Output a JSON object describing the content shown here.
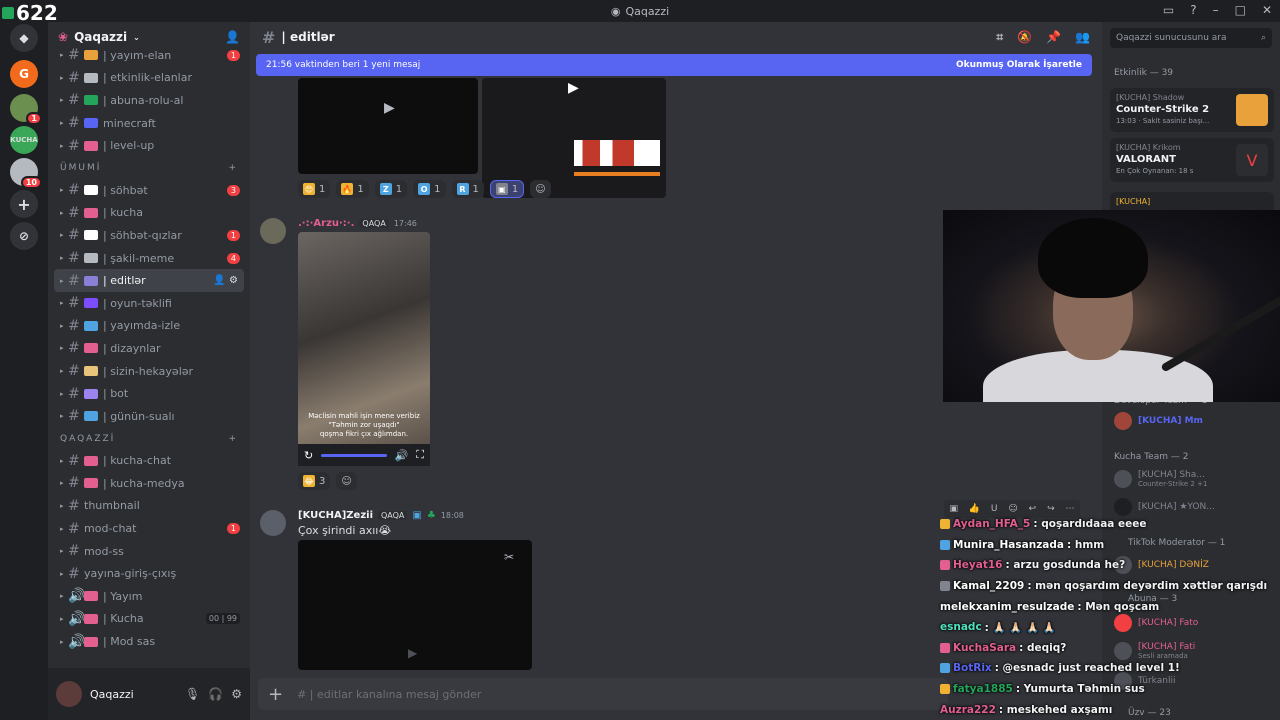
{
  "overlay": {
    "count": "622"
  },
  "window": {
    "title": "Qaqazzi"
  },
  "server": {
    "name": "Qaqazzi"
  },
  "channels": {
    "top": [
      {
        "label": "| yayım-elan",
        "badge": "1",
        "emo": "#e8a13b"
      },
      {
        "label": "| etkinlik-elanlar",
        "badge": "",
        "emo": "#b5bac1"
      },
      {
        "label": "| abuna-rolu-al",
        "badge": "",
        "emo": "#23a55a"
      },
      {
        "label": "minecraft",
        "badge": "",
        "emo": "#5865f2"
      },
      {
        "label": "| level-up",
        "badge": "",
        "emo": "#e35f8f"
      }
    ],
    "cat_umumi": "ÜMUMİ",
    "umumi": [
      {
        "label": "| söhbət",
        "badge": "3",
        "emo": "#ffffff"
      },
      {
        "label": "| kucha",
        "badge": "",
        "emo": "#e35f8f"
      },
      {
        "label": "| söhbət-qızlar",
        "badge": "1",
        "emo": "#ffffff"
      },
      {
        "label": "| şakil-meme",
        "badge": "4",
        "emo": "#b5bac1"
      },
      {
        "label": "| editlər",
        "badge": "",
        "emo": "#8a7fd6",
        "active": true
      },
      {
        "label": "| oyun-təklifi",
        "badge": "",
        "emo": "#7c4dff"
      },
      {
        "label": "| yayımda-izle",
        "badge": "",
        "emo": "#4fa3e0"
      },
      {
        "label": "| dizaynlar",
        "badge": "",
        "emo": "#e35f8f"
      },
      {
        "label": "| sizin-hekayələr",
        "badge": "",
        "emo": "#e8c47b"
      },
      {
        "label": "| bot",
        "badge": "",
        "emo": "#9b84ee"
      },
      {
        "label": "| günün-sualı",
        "badge": "",
        "emo": "#4fa3e0"
      }
    ],
    "cat_qaqazzi": "QAQAZZİ",
    "qaqazzi": [
      {
        "label": "| kucha-chat",
        "badge": "",
        "emo": "#e35f8f",
        "hash": "#"
      },
      {
        "label": "| kucha-medya",
        "badge": "",
        "emo": "#e35f8f",
        "hash": "#"
      },
      {
        "label": "thumbnail",
        "badge": "",
        "emo": "",
        "hash": "#"
      },
      {
        "label": "mod-chat",
        "badge": "1",
        "emo": "",
        "hash": "#"
      },
      {
        "label": "mod-ss",
        "badge": "",
        "emo": "",
        "hash": "#"
      },
      {
        "label": "yayına-giriş-çıxış",
        "badge": "",
        "emo": "",
        "hash": "#"
      },
      {
        "label": "| Yayım",
        "badge": "",
        "emo": "#e35f8f",
        "hash": "🔊"
      },
      {
        "label": "| Kucha",
        "badge": "",
        "emo": "#e35f8f",
        "hash": "🔊",
        "pill": "00 | 99"
      },
      {
        "label": "| Mod sas",
        "badge": "",
        "emo": "#e35f8f",
        "hash": "🔊"
      }
    ]
  },
  "user": {
    "name": "Qaqazzi"
  },
  "channel_header": {
    "name": "| editlər"
  },
  "newbar": {
    "text": "21:56 vaktinden beri 1 yeni mesaj",
    "mark": "Okunmuş Olarak İşaretle"
  },
  "reactions1": [
    {
      "e": "😍",
      "c": "1",
      "bg": "#f0b232"
    },
    {
      "e": "🔥",
      "c": "1",
      "bg": "#f0b232"
    },
    {
      "e": "Z",
      "c": "1",
      "bg": "#4fa3e0"
    },
    {
      "e": "O",
      "c": "1",
      "bg": "#4fa3e0"
    },
    {
      "e": "R",
      "c": "1",
      "bg": "#4fa3e0"
    },
    {
      "e": "▣",
      "c": "1",
      "bg": "#80848e",
      "sel": true
    }
  ],
  "msg_arzu": {
    "name": ".·:·Arzu·:·.",
    "tag": "QAQA",
    "time": "17:46",
    "caption1": "Məclisin mahli işin mene veribiz",
    "caption2": "\"Təhmin zor uşaqdı\"",
    "caption3": "qoşma fikri çıx ağlımdan."
  },
  "reactions2": [
    {
      "e": "😂",
      "c": "3",
      "bg": "#f0b232"
    }
  ],
  "msg_zezii": {
    "name": "[KUCHA]Zezii",
    "tag": "QAQA",
    "time": "18:08",
    "body": "Çox şirindi axıı😭"
  },
  "composer": {
    "placeholder": "# | editlar kanalına mesaj gönder"
  },
  "right": {
    "search": "Qaqazzi sunucusunu ara",
    "activity_label": "Etkinlik — 39",
    "activities": [
      {
        "user": "[KUCHA] Shadow",
        "game": "Counter-Strike 2",
        "sub": "13:03 · Sakit sasiniz başı..."
      },
      {
        "user": "[KUCHA] Krikom",
        "game": "VALORANT",
        "sub": "En Çok Oynanan: 18 s"
      },
      {
        "user": "[KUCHA]",
        "game": "",
        "sub": ""
      }
    ],
    "dev_team": "Developer Team — 1",
    "dev_member": "[KUCHA] Mm",
    "kucha_team": "Kucha Team — 2",
    "kucha_members": [
      {
        "name": "[KUCHA] Sha...",
        "status": "Counter-Strike 2 +1"
      },
      {
        "name": "[KUCHA] ★YON...",
        "status": ""
      }
    ],
    "tiktok": "TikTok Moderator — 1",
    "tiktok_member": "[KUCHA] DƏNİZ",
    "abuna": "Abuna — 3",
    "abuna_members": [
      {
        "name": "[KUCHA] Fato",
        "status": ""
      },
      {
        "name": "[KUCHA] Fati",
        "status": "Sesli aramada"
      },
      {
        "name": "Türkanlii",
        "status": ""
      }
    ],
    "uzv": "Üzv — 23"
  },
  "chat": [
    {
      "name": "Aydan_HFA_5",
      "color": "#e35f8f",
      "text": ": qoşardıdaaa eeee",
      "badge": "#f0b232"
    },
    {
      "name": "Munira_Hasanzada",
      "color": "#ffffff",
      "text": ": hmm",
      "badge": "#4fa3e0"
    },
    {
      "name": "Heyat16",
      "color": "#e35f8f",
      "text": ": arzu gosdunda he?",
      "badge": "#e35f8f"
    },
    {
      "name": "Kamal_2209",
      "color": "#ffffff",
      "text": ": mən qoşardım deyərdim xəttlər qarışdı",
      "badge": "#80848e"
    },
    {
      "name": "melekxanim_resulzade",
      "color": "#ffffff",
      "text": ": Mən qoşcam",
      "badge": ""
    },
    {
      "name": "esnadc",
      "color": "#4fe0c0",
      "text": ": 🙏🏻 🙏🏻 🙏🏻 🙏🏻",
      "badge": ""
    },
    {
      "name": "KuchaSara",
      "color": "#e35f8f",
      "text": ": deqiq?",
      "badge": "#e35f8f"
    },
    {
      "name": "BotRix",
      "color": "#5865f2",
      "text": ": @esnadc just reached level 1!",
      "badge": "#4fa3e0"
    },
    {
      "name": "fatya1885",
      "color": "#23a55a",
      "text": ": Yumurta Təhmin sus",
      "badge": "#f0b232"
    },
    {
      "name": "Auzra222",
      "color": "#e35f8f",
      "text": ": meskehed axşamı",
      "badge": ""
    }
  ]
}
